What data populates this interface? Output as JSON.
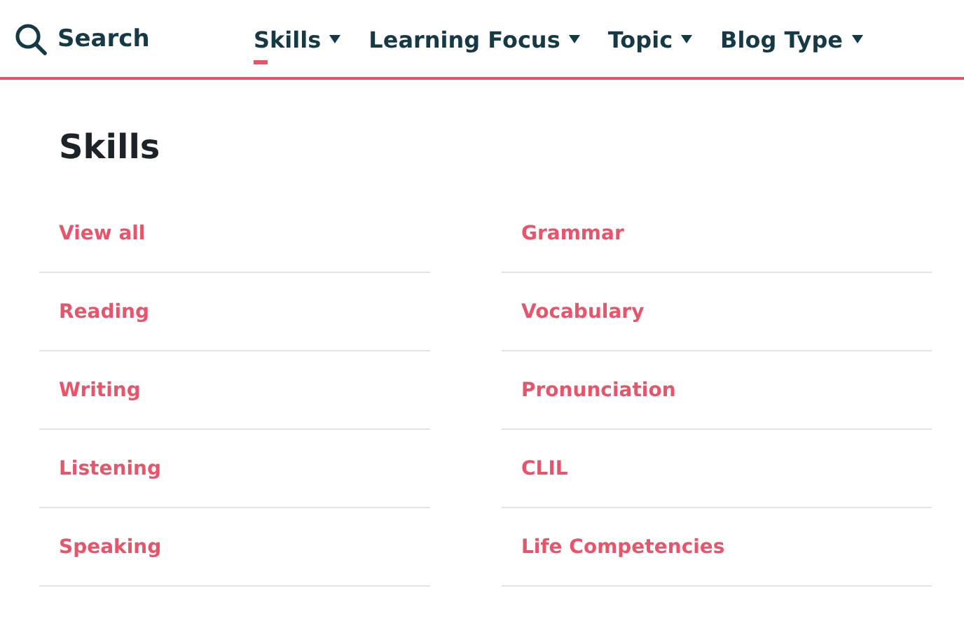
{
  "search": {
    "label": "Search"
  },
  "nav": [
    {
      "label": "Skills",
      "selected": true
    },
    {
      "label": "Learning Focus",
      "selected": false
    },
    {
      "label": "Topic",
      "selected": false
    },
    {
      "label": "Blog Type",
      "selected": false
    }
  ],
  "panel": {
    "title": "Skills",
    "columns": [
      [
        "View all",
        "Reading",
        "Writing",
        "Listening",
        "Speaking"
      ],
      [
        "Grammar",
        "Vocabulary",
        "Pronunciation",
        "CLIL",
        "Life Competencies"
      ]
    ]
  }
}
